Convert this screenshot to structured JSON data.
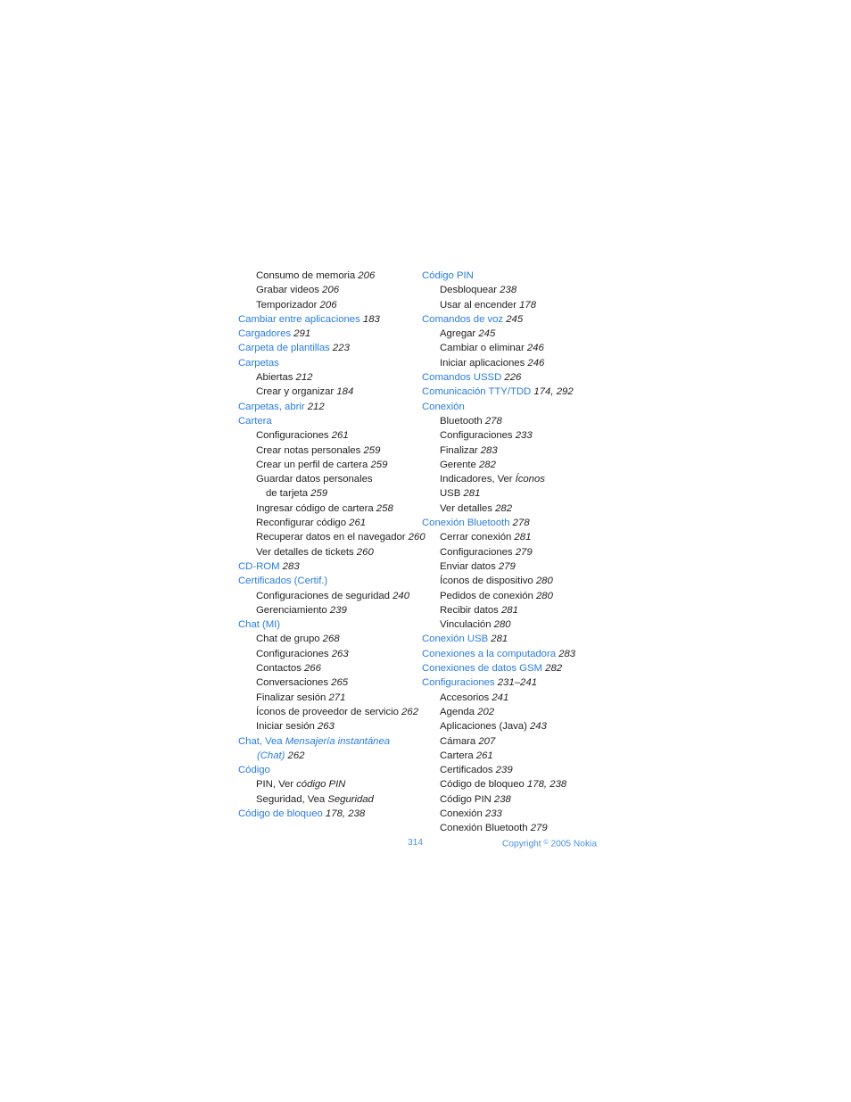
{
  "document": {
    "type": "index",
    "page_number": "314",
    "copyright": "Copyright © 2005 Nokia",
    "copyright_prefix": "Copyright ",
    "copyright_symbol": "©",
    "copyright_suffix": " 2005 Nokia",
    "accent_color": "#2a7de1",
    "body_color": "#231f20",
    "footer_color": "#4a90e2"
  },
  "columns": [
    {
      "name": "left-column",
      "entries": [
        {
          "level": 1,
          "text": "Consumo de memoria",
          "pages": "206"
        },
        {
          "level": 1,
          "text": "Grabar videos",
          "pages": "206"
        },
        {
          "level": 1,
          "text": "Temporizador",
          "pages": "206"
        },
        {
          "level": 0,
          "text": "Cambiar entre aplicaciones",
          "pages": "183"
        },
        {
          "level": 0,
          "text": "Cargadores",
          "pages": "291"
        },
        {
          "level": 0,
          "text": "Carpeta de plantillas",
          "pages": "223"
        },
        {
          "level": 0,
          "text": "Carpetas",
          "pages": ""
        },
        {
          "level": 1,
          "text": "Abiertas",
          "pages": "212"
        },
        {
          "level": 1,
          "text": "Crear y organizar",
          "pages": "184"
        },
        {
          "level": 0,
          "text": "Carpetas, abrir",
          "pages": "212"
        },
        {
          "level": 0,
          "text": "Cartera",
          "pages": ""
        },
        {
          "level": 1,
          "text": "Configuraciones",
          "pages": "261"
        },
        {
          "level": 1,
          "text": "Crear notas personales",
          "pages": "259"
        },
        {
          "level": 1,
          "text": "Crear un perfil de cartera",
          "pages": "259"
        },
        {
          "level": 1,
          "text": "Guardar datos personales",
          "pages": ""
        },
        {
          "level": 2,
          "text": "de tarjeta",
          "pages": "259"
        },
        {
          "level": 1,
          "text": "Ingresar código de cartera",
          "pages": "258"
        },
        {
          "level": 1,
          "text": "Reconfigurar código",
          "pages": "261"
        },
        {
          "level": 1,
          "text": "Recuperar datos en el navegador",
          "pages": "260"
        },
        {
          "level": 1,
          "text": "Ver detalles de tickets",
          "pages": "260"
        },
        {
          "level": 0,
          "text": "CD-ROM",
          "pages": "283"
        },
        {
          "level": 0,
          "text": "Certificados (Certif.)",
          "pages": ""
        },
        {
          "level": 1,
          "text": "Configuraciones de seguridad",
          "pages": "240"
        },
        {
          "level": 1,
          "text": "Gerenciamiento",
          "pages": "239"
        },
        {
          "level": 0,
          "text": "Chat (MI)",
          "pages": ""
        },
        {
          "level": 1,
          "text": "Chat de grupo",
          "pages": "268"
        },
        {
          "level": 1,
          "text": "Configuraciones",
          "pages": "263"
        },
        {
          "level": 1,
          "text": "Contactos",
          "pages": "266"
        },
        {
          "level": 1,
          "text": "Conversaciones",
          "pages": "265"
        },
        {
          "level": 1,
          "text": "Finalizar sesión",
          "pages": "271"
        },
        {
          "level": 1,
          "text": "Íconos de proveedor de servicio",
          "pages": "262"
        },
        {
          "level": 1,
          "text": "Iniciar sesión",
          "pages": "263"
        },
        {
          "level": 0,
          "text": "Chat, Vea ",
          "xref_blue": "Mensajería instantánea",
          "pages": ""
        },
        {
          "level": 3,
          "xref_blue": "(Chat)",
          "text": "",
          "pages": "262"
        },
        {
          "level": 0,
          "text": "Código",
          "pages": ""
        },
        {
          "level": 1,
          "text": "PIN, Ver ",
          "xref": "código PIN",
          "pages": ""
        },
        {
          "level": 1,
          "text": "Seguridad, Vea ",
          "xref": "Seguridad",
          "pages": ""
        },
        {
          "level": 0,
          "text": "Código de bloqueo",
          "pages": "178, 238"
        }
      ]
    },
    {
      "name": "right-column",
      "entries": [
        {
          "level": 0,
          "text": "Código PIN",
          "pages": ""
        },
        {
          "level": 1,
          "text": "Desbloquear",
          "pages": "238"
        },
        {
          "level": 1,
          "text": "Usar al encender",
          "pages": "178"
        },
        {
          "level": 0,
          "text": "Comandos de voz",
          "pages": "245"
        },
        {
          "level": 1,
          "text": "Agregar",
          "pages": "245"
        },
        {
          "level": 1,
          "text": "Cambiar o eliminar",
          "pages": "246"
        },
        {
          "level": 1,
          "text": "Iniciar aplicaciones",
          "pages": "246"
        },
        {
          "level": 0,
          "text": "Comandos USSD",
          "pages": "226"
        },
        {
          "level": 0,
          "text": "Comunicación TTY/TDD",
          "pages": "174, 292"
        },
        {
          "level": 0,
          "text": "Conexión",
          "pages": ""
        },
        {
          "level": 1,
          "text": "Bluetooth",
          "pages": "278"
        },
        {
          "level": 1,
          "text": "Configuraciones",
          "pages": "233"
        },
        {
          "level": 1,
          "text": "Finalizar",
          "pages": "283"
        },
        {
          "level": 1,
          "text": "Gerente",
          "pages": "282"
        },
        {
          "level": 1,
          "text": "Indicadores, Ver ",
          "xref": "Íconos",
          "pages": ""
        },
        {
          "level": 1,
          "text": "USB",
          "pages": "281"
        },
        {
          "level": 1,
          "text": "Ver detalles",
          "pages": "282"
        },
        {
          "level": 0,
          "text": "Conexión Bluetooth",
          "pages": "278"
        },
        {
          "level": 1,
          "text": "Cerrar conexión",
          "pages": "281"
        },
        {
          "level": 1,
          "text": "Configuraciones",
          "pages": "279"
        },
        {
          "level": 1,
          "text": "Enviar datos",
          "pages": "279"
        },
        {
          "level": 1,
          "text": "Íconos de dispositivo",
          "pages": "280"
        },
        {
          "level": 1,
          "text": "Pedidos de conexión",
          "pages": "280"
        },
        {
          "level": 1,
          "text": "Recibir datos",
          "pages": "281"
        },
        {
          "level": 1,
          "text": "Vinculación",
          "pages": "280"
        },
        {
          "level": 0,
          "text": "Conexión USB",
          "pages": "281"
        },
        {
          "level": 0,
          "text": "Conexiones a la computadora",
          "pages": "283"
        },
        {
          "level": 0,
          "text": "Conexiones de datos GSM",
          "pages": "282"
        },
        {
          "level": 0,
          "text": "Configuraciones",
          "pages": "231–241"
        },
        {
          "level": 1,
          "text": "Accesorios",
          "pages": "241"
        },
        {
          "level": 1,
          "text": "Agenda",
          "pages": "202"
        },
        {
          "level": 1,
          "text": "Aplicaciones (Java)",
          "pages": "243"
        },
        {
          "level": 1,
          "text": "Cámara",
          "pages": "207"
        },
        {
          "level": 1,
          "text": "Cartera",
          "pages": "261"
        },
        {
          "level": 1,
          "text": "Certificados",
          "pages": "239"
        },
        {
          "level": 1,
          "text": "Código de bloqueo",
          "pages": "178, 238"
        },
        {
          "level": 1,
          "text": "Código PIN",
          "pages": "238"
        },
        {
          "level": 1,
          "text": "Conexión",
          "pages": "233"
        },
        {
          "level": 1,
          "text": "Conexión Bluetooth",
          "pages": "279"
        }
      ]
    }
  ]
}
